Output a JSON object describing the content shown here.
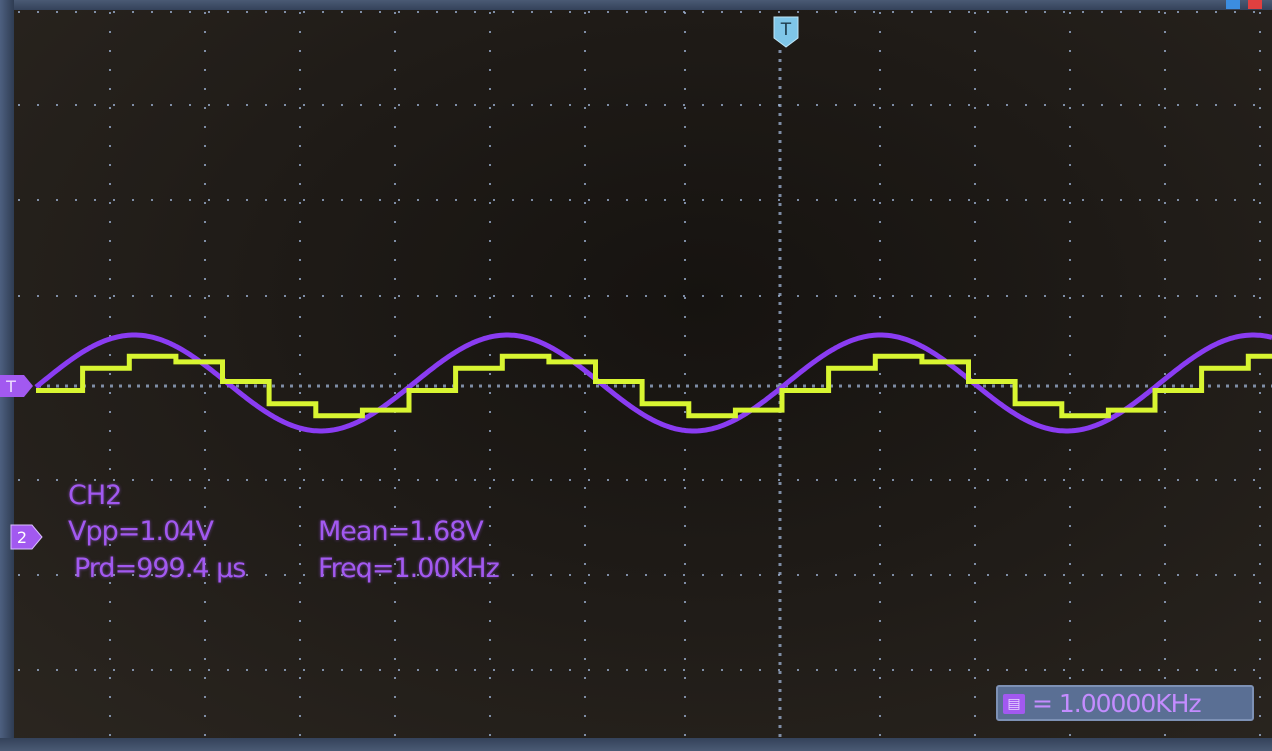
{
  "trigger": {
    "top_label": "T",
    "left_label": "T",
    "ch2_marker_label": "2"
  },
  "measurements": {
    "channel": "CH2",
    "vpp": "Vpp=1.04V",
    "mean": "Mean=1.68V",
    "period": "Prd=999.4 µs",
    "freq": "Freq=1.00KHz"
  },
  "counter": {
    "icon": "frequency-counter-icon",
    "value": "= 1.00000KHz"
  },
  "colors": {
    "ch1_trace": "#d8f531",
    "ch2_trace": "#8a3cf2",
    "grid": "#9fb4d6",
    "marker": "#7fc6e8",
    "measure_text": "#a259f0"
  }
}
